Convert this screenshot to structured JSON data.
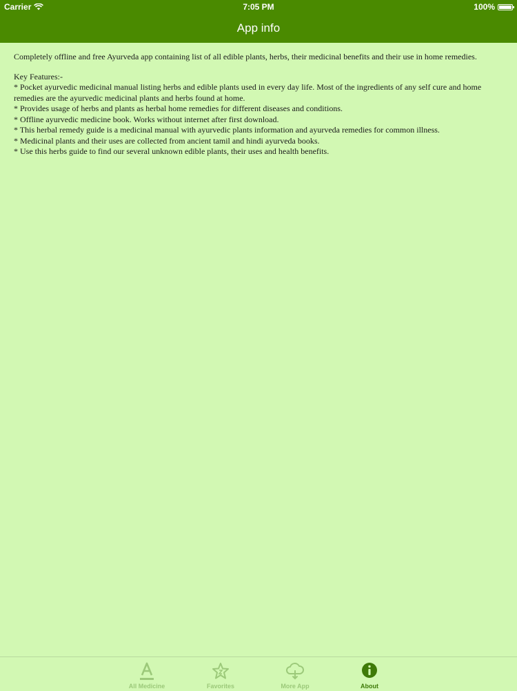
{
  "status_bar": {
    "carrier": "Carrier",
    "time": "7:05 PM",
    "battery": "100%"
  },
  "nav": {
    "title": "App info"
  },
  "content": {
    "intro": "Completely offline and free Ayurveda app containing list of all edible plants, herbs, their medicinal benefits and their use in home remedies.",
    "features_heading": "Key Features:-",
    "features": [
      "* Pocket ayurvedic medicinal manual listing herbs and edible plants used in every day life. Most of the ingredients of any self cure and home remedies are the ayurvedic medicinal plants and herbs found at home.",
      "* Provides usage of herbs and plants as herbal home remedies for different diseases and conditions.",
      "* Offline ayurvedic medicine book. Works without internet after first download.",
      "* This herbal remedy guide is a medicinal manual with ayurvedic plants information and ayurveda remedies for common illness.",
      "* Medicinal plants and their uses are collected from ancient tamil and hindi ayurveda books.",
      "* Use this herbs guide to find our several unknown edible plants, their uses and health benefits."
    ]
  },
  "tabbar": {
    "tabs": [
      {
        "label": "All Medicine",
        "icon": "letter-a-icon",
        "active": false
      },
      {
        "label": "Favorites",
        "icon": "star-icon",
        "active": false
      },
      {
        "label": "More App",
        "icon": "cloud-download-icon",
        "active": false
      },
      {
        "label": "About",
        "icon": "info-icon",
        "active": true
      }
    ]
  },
  "colors": {
    "header": "#4a8a00",
    "background": "#d2f8b3",
    "tab_inactive": "#9cc97a",
    "tab_active": "#3e7a08"
  }
}
